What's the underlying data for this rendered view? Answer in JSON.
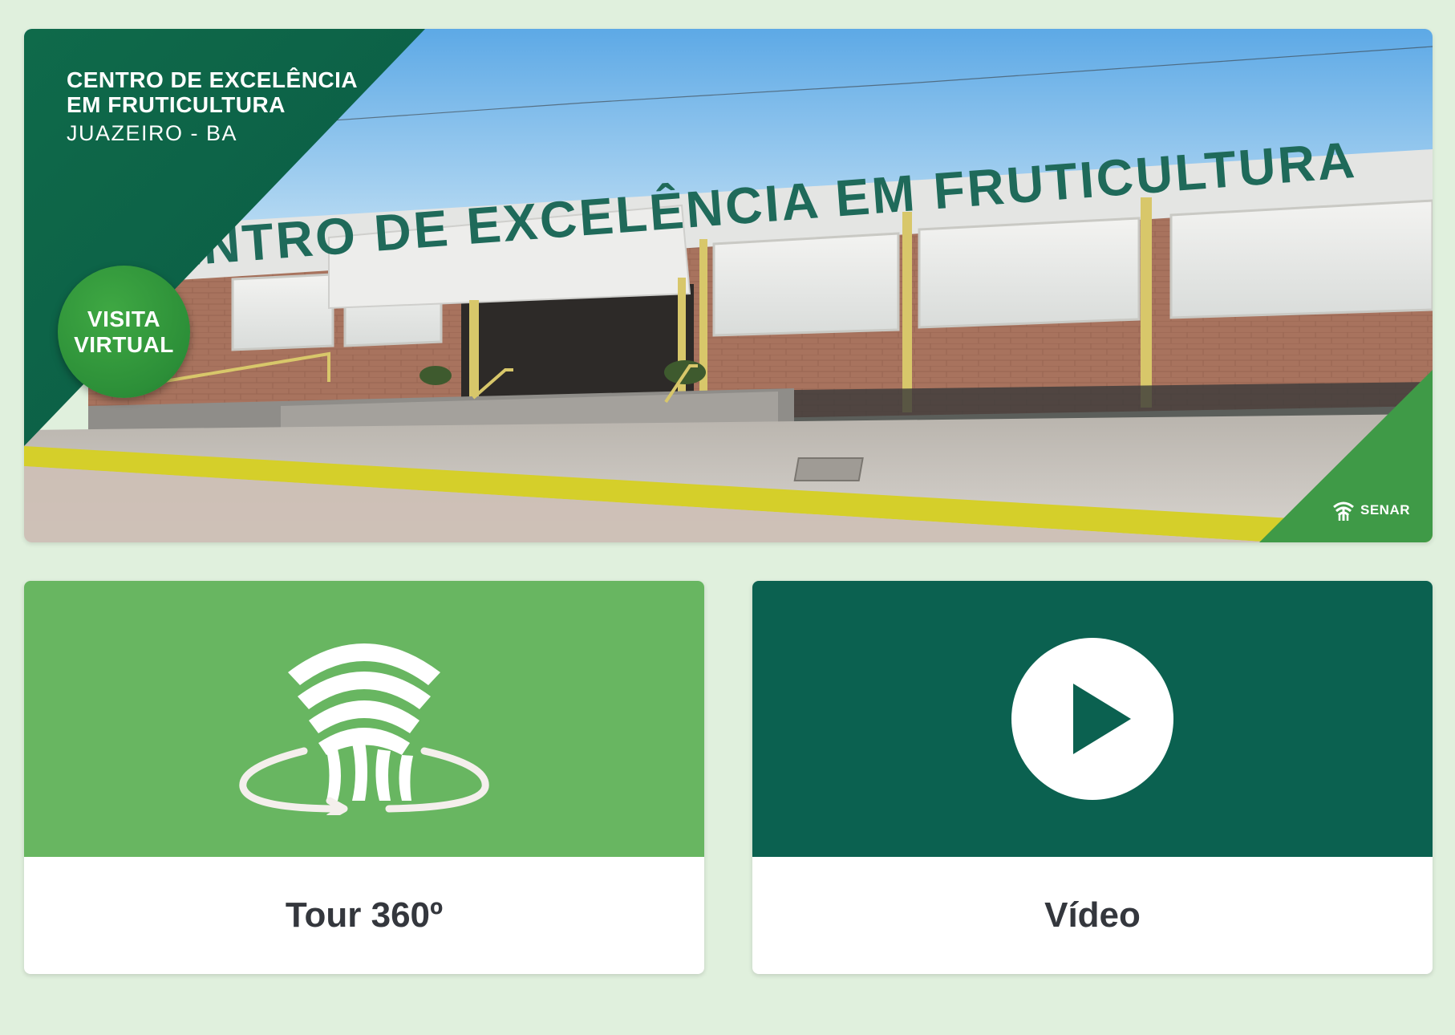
{
  "hero": {
    "title_line1": "CENTRO DE EXCELÊNCIA",
    "title_line2": "EM FRUTICULTURA",
    "city": "JUAZEIRO - BA",
    "facade_text": "CENTRO DE EXCELÊNCIA EM FRUTICULTURA",
    "badge_line1": "VISITA",
    "badge_line2": "VIRTUAL",
    "brand": "SENAR"
  },
  "cards": {
    "tour": {
      "label": "Tour 360º",
      "icon": "tour-360-icon"
    },
    "video": {
      "label": "Vídeo",
      "icon": "play-icon"
    }
  },
  "colors": {
    "background": "#e0f0dd",
    "dark_green": "#0b6150",
    "light_green": "#68b661",
    "badge_green": "#2c8f38",
    "label_text": "#34373d"
  }
}
